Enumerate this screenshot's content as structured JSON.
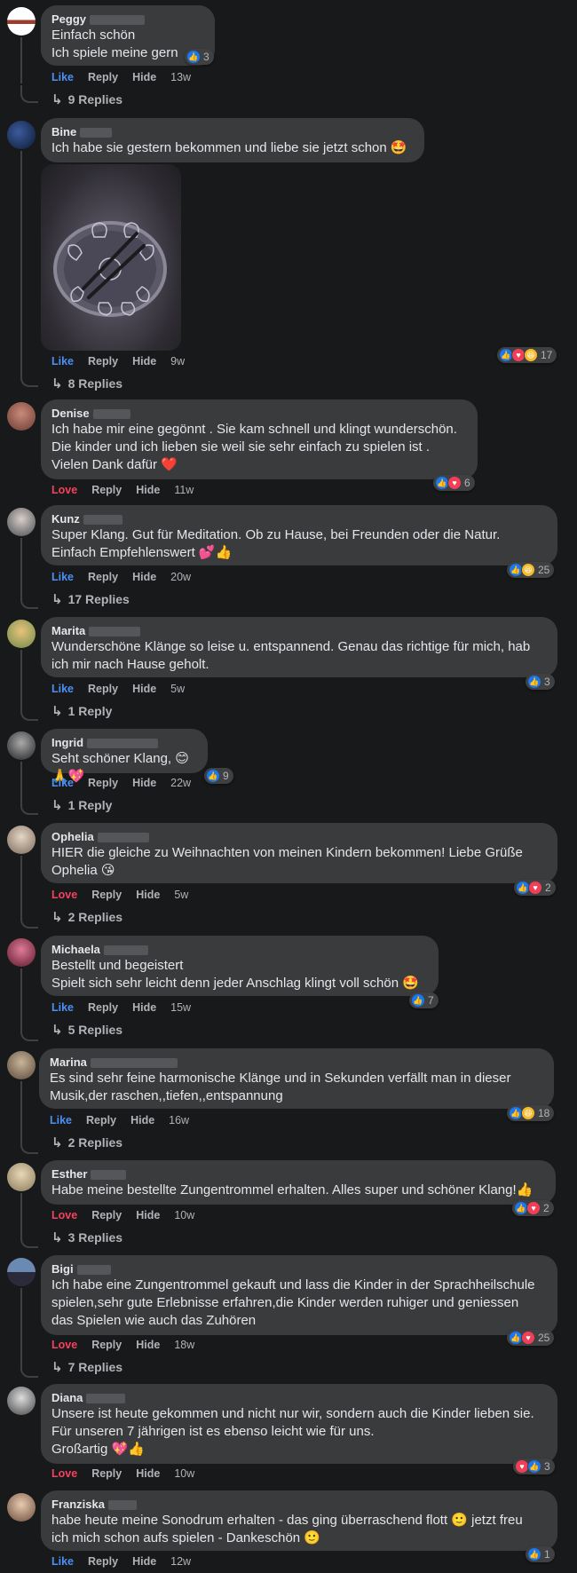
{
  "comments": [
    {
      "author": "Peggy",
      "text": "Einfach schön\nIch spiele meine gern",
      "reaction_count": "3",
      "like_label": "Like",
      "reply_label": "Reply",
      "hide_label": "Hide",
      "time": "13w",
      "replies": "9 Replies"
    },
    {
      "author": "Bine",
      "text": "Ich habe sie gestern bekommen und liebe sie jetzt schon 🤩",
      "reaction_count": "17",
      "like_label": "Like",
      "reply_label": "Reply",
      "hide_label": "Hide",
      "time": "9w",
      "replies": "8 Replies"
    },
    {
      "author": "Denise",
      "text": "Ich habe mir eine gegönnt . Sie kam schnell und klingt wunderschön.\nDie kinder und ich lieben sie weil sie sehr einfach zu spielen ist .\nVielen Dank dafür ❤️",
      "reaction_count": "6",
      "like_label": "Love",
      "reply_label": "Reply",
      "hide_label": "Hide",
      "time": "11w"
    },
    {
      "author": "Kunz",
      "text": "Super Klang. Gut für Meditation. Ob zu Hause, bei Freunden oder die Natur.\nEinfach Empfehlenswert 💕👍",
      "reaction_count": "25",
      "like_label": "Like",
      "reply_label": "Reply",
      "hide_label": "Hide",
      "time": "20w",
      "replies": "17 Replies"
    },
    {
      "author": "Marita",
      "text": "Wunderschöne Klänge so leise u. entspannend. Genau das richtige für mich, hab\nich mir nach Hause geholt.",
      "reaction_count": "3",
      "like_label": "Like",
      "reply_label": "Reply",
      "hide_label": "Hide",
      "time": "5w",
      "replies": "1 Reply"
    },
    {
      "author": "Ingrid",
      "text": "Seht schöner Klang, 😊🙏💖",
      "reaction_count": "9",
      "like_label": "Like",
      "reply_label": "Reply",
      "hide_label": "Hide",
      "time": "22w",
      "replies": "1 Reply"
    },
    {
      "author": "Ophelia",
      "text": "HIER die gleiche zu Weihnachten von meinen Kindern bekommen! Liebe Grüße\nOphelia 😘",
      "reaction_count": "2",
      "like_label": "Love",
      "reply_label": "Reply",
      "hide_label": "Hide",
      "time": "5w",
      "replies": "2 Replies"
    },
    {
      "author": "Michaela",
      "text": "Bestellt und begeistert\nSpielt sich sehr leicht denn jeder Anschlag klingt voll schön 🤩",
      "reaction_count": "7",
      "like_label": "Like",
      "reply_label": "Reply",
      "hide_label": "Hide",
      "time": "15w",
      "replies": "5 Replies"
    },
    {
      "author": "Marina",
      "text": "Es sind sehr feine harmonische Klänge und in Sekunden verfällt man in dieser\nMusik,der raschen,,tiefen,,entspannung",
      "reaction_count": "18",
      "like_label": "Like",
      "reply_label": "Reply",
      "hide_label": "Hide",
      "time": "16w",
      "replies": "2 Replies"
    },
    {
      "author": "Esther",
      "text": "Habe meine bestellte Zungentrommel erhalten. Alles super und schöner Klang!👍",
      "reaction_count": "2",
      "like_label": "Love",
      "reply_label": "Reply",
      "hide_label": "Hide",
      "time": "10w",
      "replies": "3 Replies"
    },
    {
      "author": "Bigi",
      "text": "Ich habe eine Zungentrommel gekauft und lass die Kinder in der Sprachheilschule\nspielen,sehr gute Erlebnisse erfahren,die Kinder werden ruhiger und geniessen\ndas Spielen wie auch das Zuhören",
      "reaction_count": "25",
      "like_label": "Love",
      "reply_label": "Reply",
      "hide_label": "Hide",
      "time": "18w",
      "replies": "7 Replies"
    },
    {
      "author": "Diana",
      "text": "Unsere ist heute gekommen und nicht nur wir, sondern auch die Kinder lieben sie.\nFür unseren 7 jährigen ist es ebenso leicht wie für uns.\nGroßartig 💖👍",
      "reaction_count": "3",
      "like_label": "Love",
      "reply_label": "Reply",
      "hide_label": "Hide",
      "time": "10w"
    },
    {
      "author": "Franziska",
      "text": "habe heute meine Sonodrum erhalten - das ging überraschend flott 🙂 jetzt freu\nich mich schon aufs spielen - Dankeschön 🙂",
      "reaction_count": "1",
      "like_label": "Like",
      "reply_label": "Reply",
      "hide_label": "Hide",
      "time": "12w"
    }
  ],
  "colors": {
    "background": "#18191a",
    "bubble": "#3a3b3c",
    "like": "#4c8ff5",
    "love": "#f3425f",
    "muted": "#b0b3b8"
  }
}
